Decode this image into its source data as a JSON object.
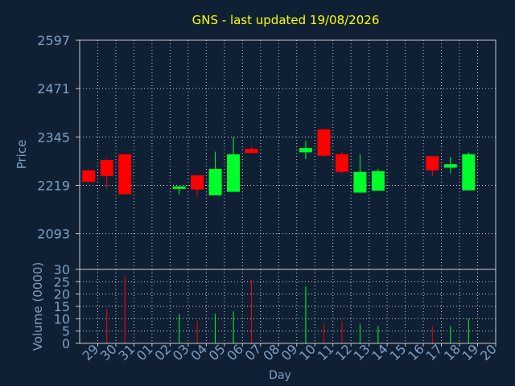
{
  "title": "GNS - last updated 19/08/2026",
  "colors": {
    "background": "#0f2035",
    "plot_border": "#c8c8c8",
    "grid": "#d0d0d0",
    "title": "#ffff00",
    "axis_text": "#7f9ec0",
    "up": "#00ff2a",
    "down": "#ff0000"
  },
  "chart_data": [
    {
      "type": "candlestick",
      "ylabel": "Price",
      "ylim": [
        2000,
        2597
      ],
      "yticks": [
        2093,
        2219,
        2345,
        2471,
        2597
      ],
      "grid": true,
      "categories": [
        "29",
        "30",
        "31",
        "01",
        "02",
        "03",
        "04",
        "05",
        "06",
        "07",
        "08",
        "09",
        "10",
        "11",
        "12",
        "13",
        "14",
        "15",
        "16",
        "17",
        "18",
        "19",
        "20"
      ],
      "candles": [
        {
          "day": "29",
          "open": 2258,
          "high": 2260,
          "low": 2228,
          "close": 2228
        },
        {
          "day": "30",
          "open": 2285,
          "high": 2289,
          "low": 2210,
          "close": 2243
        },
        {
          "day": "31",
          "open": 2300,
          "high": 2300,
          "low": 2193,
          "close": 2196
        },
        {
          "day": "03",
          "open": 2208,
          "high": 2214,
          "low": 2195,
          "close": 2213
        },
        {
          "day": "04",
          "open": 2245,
          "high": 2245,
          "low": 2187,
          "close": 2208
        },
        {
          "day": "05",
          "open": 2193,
          "high": 2307,
          "low": 2193,
          "close": 2262
        },
        {
          "day": "06",
          "open": 2202,
          "high": 2345,
          "low": 2202,
          "close": 2300
        },
        {
          "day": "07",
          "open": 2314,
          "high": 2320,
          "low": 2303,
          "close": 2303
        },
        {
          "day": "10",
          "open": 2305,
          "high": 2335,
          "low": 2287,
          "close": 2316
        },
        {
          "day": "11",
          "open": 2365,
          "high": 2365,
          "low": 2293,
          "close": 2296
        },
        {
          "day": "12",
          "open": 2300,
          "high": 2305,
          "low": 2250,
          "close": 2254
        },
        {
          "day": "13",
          "open": 2200,
          "high": 2300,
          "low": 2200,
          "close": 2254
        },
        {
          "day": "14",
          "open": 2205,
          "high": 2262,
          "low": 2205,
          "close": 2256
        },
        {
          "day": "17",
          "open": 2295,
          "high": 2295,
          "low": 2243,
          "close": 2258
        },
        {
          "day": "18",
          "open": 2265,
          "high": 2293,
          "low": 2250,
          "close": 2274
        },
        {
          "day": "19",
          "open": 2206,
          "high": 2305,
          "low": 2206,
          "close": 2300
        }
      ]
    },
    {
      "type": "bar",
      "ylabel": "Volume (0000)",
      "xlabel": "Day",
      "ylim": [
        0,
        30
      ],
      "yticks": [
        0,
        5,
        10,
        15,
        20,
        25,
        30
      ],
      "grid": true,
      "categories": [
        "29",
        "30",
        "31",
        "01",
        "02",
        "03",
        "04",
        "05",
        "06",
        "07",
        "08",
        "09",
        "10",
        "11",
        "12",
        "13",
        "14",
        "15",
        "16",
        "17",
        "18",
        "19",
        "20"
      ],
      "bars": [
        {
          "day": "30",
          "value": 14,
          "direction": "down"
        },
        {
          "day": "31",
          "value": 27,
          "direction": "down"
        },
        {
          "day": "03",
          "value": 12,
          "direction": "up"
        },
        {
          "day": "04",
          "value": 9,
          "direction": "down"
        },
        {
          "day": "05",
          "value": 12,
          "direction": "up"
        },
        {
          "day": "06",
          "value": 13,
          "direction": "up"
        },
        {
          "day": "07",
          "value": 26,
          "direction": "down"
        },
        {
          "day": "10",
          "value": 23,
          "direction": "up"
        },
        {
          "day": "11",
          "value": 8,
          "direction": "down"
        },
        {
          "day": "12",
          "value": 9,
          "direction": "down"
        },
        {
          "day": "13",
          "value": 8,
          "direction": "up"
        },
        {
          "day": "14",
          "value": 7,
          "direction": "up"
        },
        {
          "day": "17",
          "value": 7,
          "direction": "down"
        },
        {
          "day": "18",
          "value": 7,
          "direction": "up"
        },
        {
          "day": "19",
          "value": 10,
          "direction": "up"
        }
      ]
    }
  ]
}
